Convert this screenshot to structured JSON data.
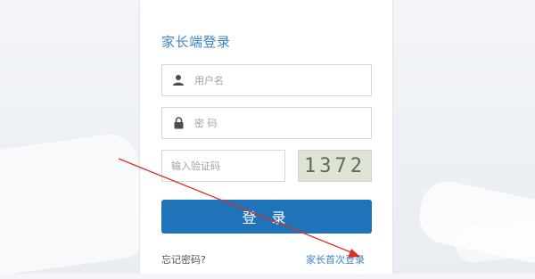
{
  "title": "家长端登录",
  "username": {
    "placeholder": "用户名",
    "value": ""
  },
  "password": {
    "placeholder": "密 码",
    "value": ""
  },
  "captcha": {
    "placeholder": "输入验证码",
    "value": "",
    "image_text": "1372"
  },
  "login_button": "登 录",
  "forgot_link": "忘记密码?",
  "first_login_link": "家长首次登录",
  "colors": {
    "accent": "#1e73b9",
    "title": "#3d86c6",
    "annotation_arrow": "#d93025"
  },
  "icons": {
    "username": "user-icon",
    "password": "lock-icon"
  }
}
